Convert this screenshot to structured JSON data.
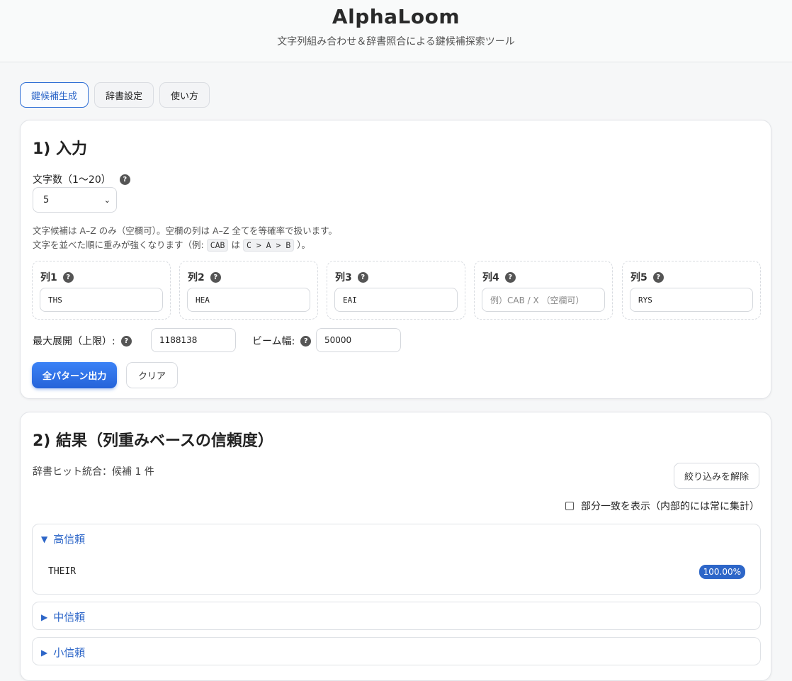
{
  "header": {
    "title": "AlphaLoom",
    "subtitle": "文字列組み合わせ＆辞書照合による鍵候補探索ツール"
  },
  "tabs": [
    {
      "label": "鍵候補生成",
      "active": true
    },
    {
      "label": "辞書設定",
      "active": false
    },
    {
      "label": "使い方",
      "active": false
    }
  ],
  "input_section": {
    "heading": "1) 入力",
    "length_label": "文字数（1〜20）",
    "length_value": "5",
    "hint_line1_pre": "文字候補は A–Z のみ（空欄可）。空欄の列は A–Z 全てを等確率で扱います。",
    "hint_line2_pre": "文字を並べた順に重みが強くなります（例:",
    "hint_code1": "CAB",
    "hint_mid": "は",
    "hint_code2": "C > A > B",
    "hint_end": "）。",
    "columns": [
      {
        "label": "列1",
        "value": "THS",
        "placeholder": ""
      },
      {
        "label": "列2",
        "value": "HEA",
        "placeholder": ""
      },
      {
        "label": "列3",
        "value": "EAI",
        "placeholder": ""
      },
      {
        "label": "列4",
        "value": "",
        "placeholder": "例）CAB / X （空欄可）"
      },
      {
        "label": "列5",
        "value": "RYS",
        "placeholder": ""
      }
    ],
    "max_expand_label": "最大展開（上限）:",
    "max_expand_value": "1188138",
    "beam_label": "ビーム幅:",
    "beam_value": "50000",
    "run_button": "全パターン出力",
    "clear_button": "クリア"
  },
  "result_section": {
    "heading": "2) 結果（列重みベースの信頼度）",
    "summary": "辞書ヒット統合：候補 1 件",
    "clear_filter_button": "絞り込みを解除",
    "partial_toggle_label": "部分一致を表示（内部的には常に集計）",
    "groups": [
      {
        "label": "高信頼",
        "expanded": true,
        "items": [
          {
            "word": "THEIR",
            "confidence": "100.00%"
          }
        ]
      },
      {
        "label": "中信頼",
        "expanded": false,
        "items": []
      },
      {
        "label": "小信頼",
        "expanded": false,
        "items": []
      }
    ]
  },
  "icons": {
    "help": "help-icon",
    "chevron": "chevron-down-icon",
    "expanded": "triangle-down-icon",
    "collapsed": "triangle-right-icon"
  },
  "colors": {
    "accent": "#2d66c8",
    "primary_button": "#2563d9"
  }
}
